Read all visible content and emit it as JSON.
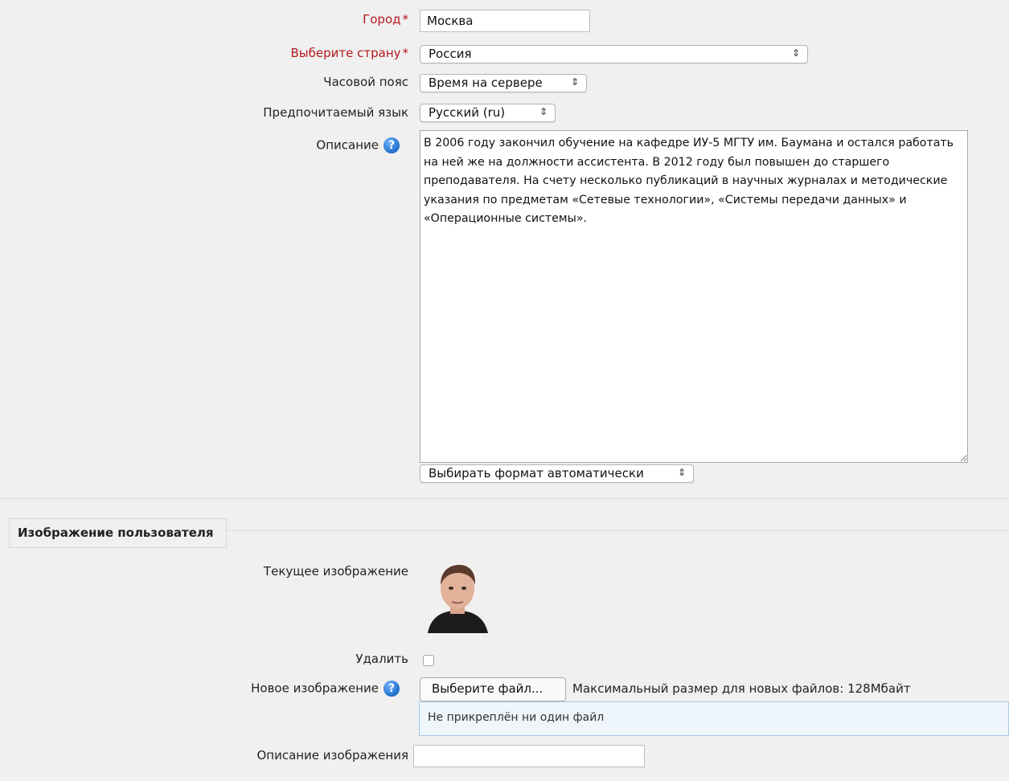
{
  "form": {
    "city": {
      "label": "Город",
      "required_mark": "*",
      "value": "Москва"
    },
    "country": {
      "label": "Выберите страну",
      "required_mark": "*",
      "selected": "Россия"
    },
    "timezone": {
      "label": "Часовой пояс",
      "selected": "Время на сервере"
    },
    "language": {
      "label": "Предпочитаемый язык",
      "selected": "Русский (ru)"
    },
    "description": {
      "label": "Описание",
      "help_icon": "?",
      "text": "В 2006 году закончил обучение на кафедре ИУ-5 МГТУ им. Баумана и остался работать на ней же на должности ассистента. В 2012 году был повышен до старшего преподавателя. На счету несколько публикаций в научных журналах и методические указания по предметам «Сетевые технологии», «Системы передачи данных» и «Операционные системы».",
      "format_selected": "Выбирать формат автоматически"
    }
  },
  "user_image": {
    "section_title": "Изображение пользователя",
    "current_label": "Текущее изображение",
    "delete_label": "Удалить",
    "new_label": "Новое изображение",
    "help_icon": "?",
    "choose_button": "Выберите файл...",
    "max_size_text": "Максимальный размер для новых файлов: 128Мбайт",
    "dropzone_text": "Не прикреплён ни один файл",
    "image_desc_label": "Описание изображения",
    "image_desc_value": ""
  },
  "colors": {
    "required": "#b4181b",
    "help": "#2f7fd6"
  }
}
